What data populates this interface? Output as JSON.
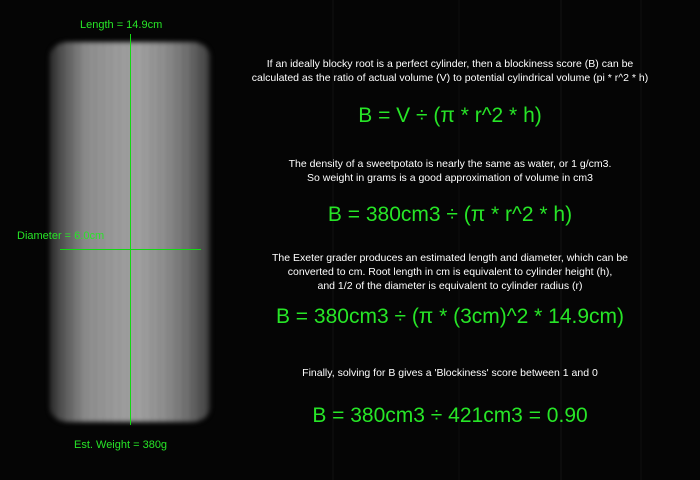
{
  "measurements": {
    "length": "Length = 14.9cm",
    "diameter": "Diameter = 6.0cm",
    "weight": "Est. Weight = 380g"
  },
  "explanation": {
    "intro_line1": "If an ideally blocky root is a perfect cylinder, then a blockiness score (B) can be",
    "intro_line2": "calculated as the ratio of actual volume (V) to potential cylindrical volume (pi * r^2 * h)",
    "equation1": "B = V ÷ (π * r^2 * h)",
    "density_line1": "The density of a sweetpotato is nearly the same as water, or 1 g/cm3.",
    "density_line2": "So weight in grams is a good approximation of volume in cm3",
    "equation2": "B = 380cm3 ÷ (π * r^2 * h)",
    "exeter_line1": "The Exeter grader produces an estimated length and diameter, which can be",
    "exeter_line2": "converted to cm. Root length in cm is equivalent to cylinder height (h),",
    "exeter_line3": "and 1/2 of the diameter is equivalent to cylinder radius (r)",
    "equation3": "B = 380cm3 ÷ (π * (3cm)^2 * 14.9cm)",
    "finally": "Finally, solving for B gives a 'Blockiness' score between 1 and 0",
    "equation4": "B = 380cm3 ÷ 421cm3 = 0.90"
  },
  "colors": {
    "guide_green": "#27e527",
    "background": "#050505",
    "body_text": "#ffffff"
  }
}
